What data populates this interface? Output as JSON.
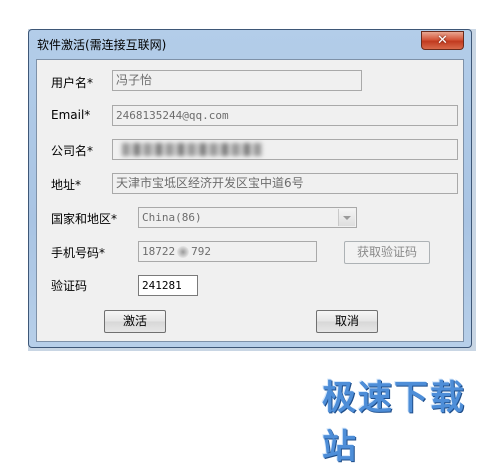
{
  "window": {
    "title": "软件激活(需连接互联网)",
    "close_label": "✕"
  },
  "form": {
    "username_label": "用户名*",
    "username_value": "冯子怡",
    "email_label": "Email*",
    "email_value": "2468135244@qq.com",
    "company_label": "公司名*",
    "address_label": "地址*",
    "address_value": "天津市宝坻区经济开发区宝中道6号",
    "country_label": "国家和地区*",
    "country_value": "China(86)",
    "phone_label": "手机号码*",
    "phone_prefix": "18722",
    "phone_suffix": "792",
    "get_code_label": "获取验证码",
    "code_label": "验证码",
    "code_value": "241281"
  },
  "buttons": {
    "activate_label": "激活",
    "cancel_label": "取消"
  },
  "watermark": "极速下载站"
}
